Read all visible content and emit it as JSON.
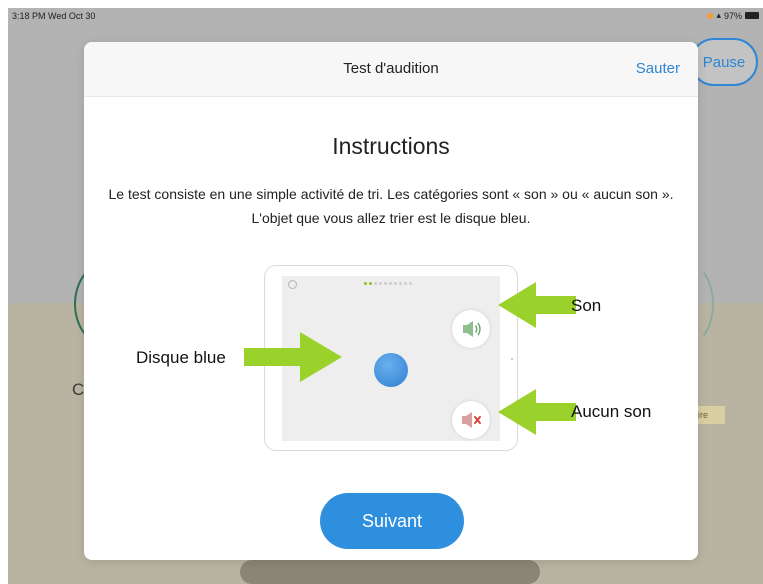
{
  "status_bar": {
    "time": "3:18 PM  Wed Oct 30",
    "battery": "97%"
  },
  "background": {
    "pause_label": "Pause",
    "partial_letter": "C",
    "partial_tag": "ire"
  },
  "modal": {
    "title": "Test d'audition",
    "skip_label": "Sauter",
    "heading": "Instructions",
    "description": "Le test consiste en une simple activité de tri. Les catégories sont « son » ou « aucun son ». L'objet que vous allez trier est le disque bleu.",
    "illustration": {
      "disc_label": "Disque blue",
      "sound_label": "Son",
      "no_sound_label": "Aucun son",
      "icons": [
        "speaker-on-icon",
        "speaker-muted-icon",
        "blue-disc"
      ]
    },
    "next_label": "Suivant"
  },
  "colors": {
    "accent": "#2e86d4",
    "arrow": "#9bd12b",
    "disc": "#2f7fd0"
  }
}
